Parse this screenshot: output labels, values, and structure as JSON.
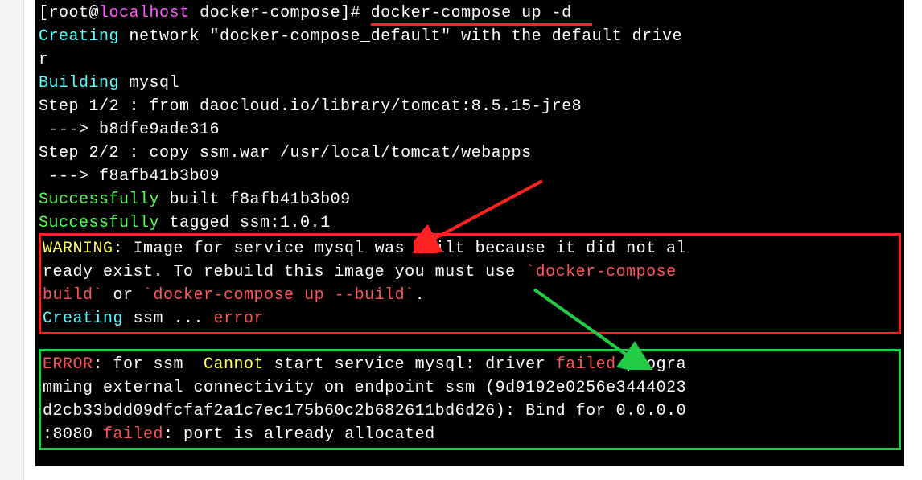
{
  "prompt": {
    "user": "root",
    "host": "localhost",
    "cwd": "docker-compose",
    "command": "docker-compose up -d"
  },
  "lines": {
    "creating_network": {
      "label": "Creating",
      "rest": " network \"docker-compose_default\" with the default drive"
    },
    "creating_network_wrap": "r",
    "building": {
      "label": "Building",
      "rest": " mysql"
    },
    "step1": "Step 1/2 : from daocloud.io/library/tomcat:8.5.15-jre8",
    "step1_hash": " ---> b8dfe9ade316",
    "step2": "Step 2/2 : copy ssm.war /usr/local/tomcat/webapps",
    "step2_hash": " ---> f8afb41b3b09",
    "success_built": {
      "label": "Successfully",
      "rest": " built f8afb41b3b09"
    },
    "success_tagged": {
      "label": "Successfully",
      "rest": " tagged ssm:1.0.1"
    }
  },
  "warning": {
    "label": "WARNING",
    "text1": ": Image for service mysql was built because it did not al",
    "text2": "ready exist. To rebuild this image you must use ",
    "cmd1": "`docker-compose ",
    "cmd1b": "build`",
    "or": " or ",
    "cmd2": "`docker-compose up --build`",
    "dot": ".",
    "creating": {
      "label": "Creating",
      "ssm": " ssm ... ",
      "error": "error"
    }
  },
  "error": {
    "label": "ERROR",
    "for_ssm": ": for ssm  ",
    "cannot": "Cannot",
    "text1": " start service mysql: driver ",
    "failed1": "failed",
    "text2": " progra",
    "text3": "mming external connectivity on endpoint ssm (9d9192e0256e3444023",
    "text4": "d2cb33bdd09dfcfaf2a1c7ec175b60c2b682611bd6d26): Bind for 0.0.0.0",
    "text5": ":8080 ",
    "failed2": "failed",
    "text6": ": port is already allocated"
  }
}
